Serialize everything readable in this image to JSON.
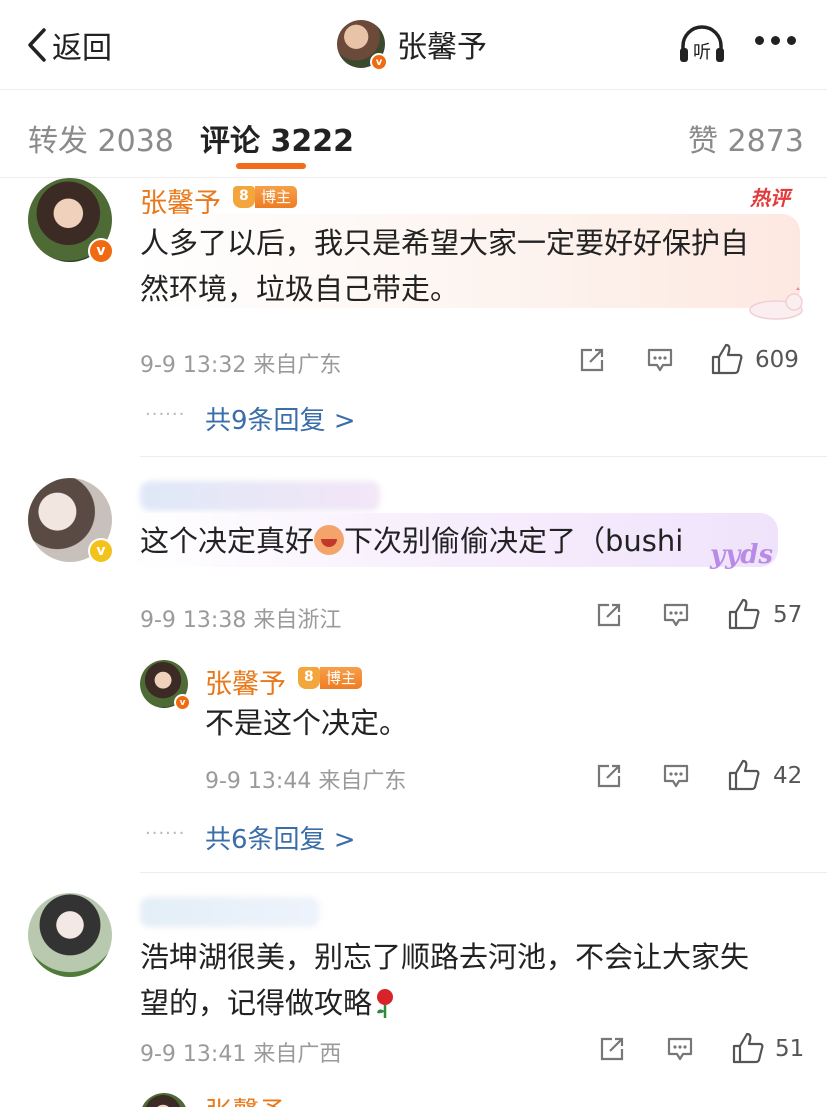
{
  "nav": {
    "back_label": "返回",
    "title": "张馨予",
    "listen_label": "听"
  },
  "tabs": [
    {
      "label": "转发 2038"
    },
    {
      "label": "评论 3222"
    },
    {
      "label": "赞 2873"
    }
  ],
  "comments": [
    {
      "user": "张馨予",
      "tag": "博主",
      "hot_label": "热评",
      "text_line1": "人多了以后，我只是希望大家一定要好好保护自",
      "text_line2": "然环境，垃圾自己带走。",
      "time": "9-9 13:32 来自广东",
      "likes": "609",
      "dots": "······",
      "replies": "共9条回复 >"
    },
    {
      "user": "",
      "text_a": "这个决定真好",
      "text_b": "下次别偷偷决定了（bushi",
      "sticker": "yyds",
      "time": "9-9 13:38 来自浙江",
      "likes": "57",
      "reply": {
        "user": "张馨予",
        "tag": "博主",
        "text": "不是这个决定。",
        "time": "9-9 13:44 来自广东",
        "likes": "42"
      },
      "dots": "······",
      "replies": "共6条回复 >"
    },
    {
      "user": "",
      "text_line1": "浩坤湖很美，别忘了顺路去河池，不会让大家失",
      "text_line2": "望的，记得做攻略",
      "time": "9-9 13:41 来自广西",
      "likes": "51"
    },
    {
      "user": "张馨予"
    }
  ],
  "colors": {
    "accent": "#f26a1b",
    "username": "#e8781a",
    "link": "#3b6ea8",
    "meta": "#9a9a9a"
  },
  "icons": [
    "chevron-left-icon",
    "headphone-icon",
    "more-icon",
    "share-icon",
    "comment-icon",
    "like-icon",
    "verified-icon",
    "crown-icon",
    "laugh-emoji",
    "rose-emoji"
  ]
}
